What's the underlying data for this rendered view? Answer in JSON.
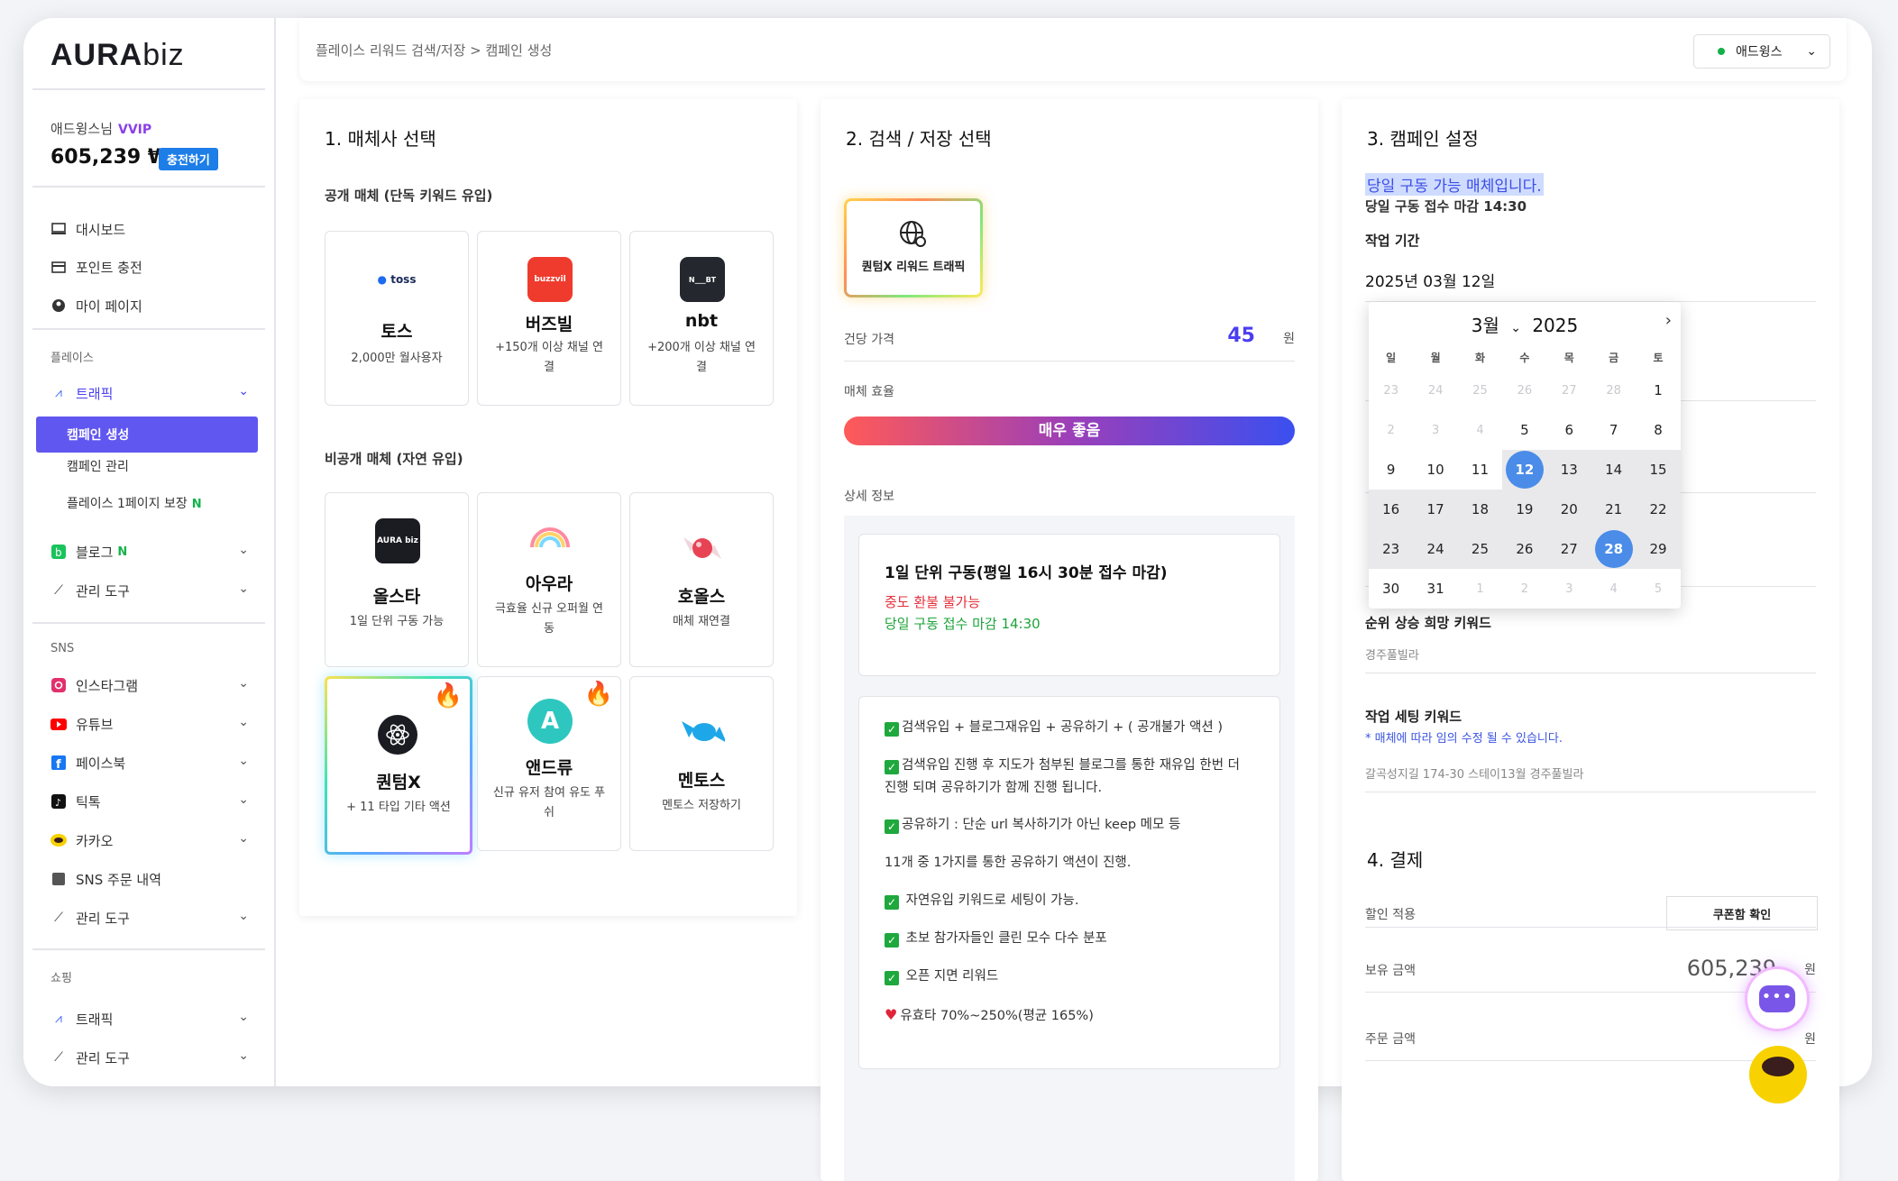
{
  "brand": {
    "name_main": "AURA",
    "name_sub": "biz"
  },
  "user": {
    "name": "애드윙스님",
    "tier": "VVIP",
    "balance": "605,239 ₩",
    "charge_label": "충전하기"
  },
  "sidebar": {
    "top": [
      {
        "label": "대시보드",
        "icon": "monitor-icon"
      },
      {
        "label": "포인트 충전",
        "icon": "card-icon"
      },
      {
        "label": "마이 페이지",
        "icon": "user-icon"
      }
    ],
    "place_title": "플레이스",
    "traffic": "트래픽",
    "campaign_create": "캠페인 생성",
    "campaign_manage": "캠페인 관리",
    "place_first_page": "플레이스 1페이지 보장",
    "new_badge": "N",
    "blog": "블로그",
    "manage_tool": "관리 도구",
    "sns_title": "SNS",
    "sns": [
      "인스타그램",
      "유튜브",
      "페이스북",
      "틱톡",
      "카카오"
    ],
    "sns_orders": "SNS 주문 내역",
    "shopping_title": "쇼핑"
  },
  "header": {
    "breadcrumb": "플레이스 리워드 검색/저장 > 캠페인 생성",
    "account": "애드윙스"
  },
  "panel1": {
    "title": "1. 매체사 선택",
    "public_label": "공개 매체 (단독 키워드 유입)",
    "private_label": "비공개 매체 (자연 유입)",
    "public": [
      {
        "name": "토스",
        "desc": "2,000만 월사용자",
        "logo": "toss"
      },
      {
        "name": "버즈빌",
        "desc": "+150개 이상 채널 연결",
        "logo": "buzzvil"
      },
      {
        "name": "nbt",
        "desc": "+200개 이상 채널 연결",
        "logo": "N___BT"
      }
    ],
    "private": [
      {
        "name": "올스타",
        "desc": "1일 단위 구동 가능",
        "logo": "AURA biz"
      },
      {
        "name": "아우라",
        "desc": "극효율 신규 오퍼월 연동"
      },
      {
        "name": "호올스",
        "desc": "매체 재연결"
      },
      {
        "name": "퀀텀X",
        "desc": "+ 11 타입 기타 액션"
      },
      {
        "name": "앤드류",
        "desc": "신규 유저 참여 유도 푸쉬",
        "logo": "A"
      },
      {
        "name": "멘토스",
        "desc": "멘토스 저장하기"
      }
    ]
  },
  "panel2": {
    "title": "2. 검색 / 저장 선택",
    "method": "퀀텀X 리워드 트래픽",
    "price_label": "건당 가격",
    "price": "45",
    "price_unit": "원",
    "efficiency_label": "매체 효율",
    "efficiency": "매우 좋음",
    "detail_label": "상세 정보",
    "info_title": "1일 단위 구동(평일 16시 30분 접수 마감)",
    "info_red": "중도 환불 불가능",
    "info_green": "당일 구동 접수 마감 14:30",
    "features": [
      "검색유입 + 블로그재유입 + 공유하기 + ( 공개불가 액션 )",
      "검색유입 진행 후 지도가 첨부된 블로그를 통한 재유입 한번 더 진행 되며 공유하기가 함께 진행 됩니다.",
      "공유하기 : 단순 url 복사하기가 아닌 keep 메모 등",
      "11개 중 1가지를 통한 공유하기 액션이 진행.",
      "자연유입 키워드로 세팅이 가능.",
      "초보 참가자들인 클린 모수 다수 분포",
      "오픈 지면 리워드",
      "유효타 70%~250%(평균 165%)"
    ]
  },
  "panel3": {
    "title": "3. 캠페인 설정",
    "avail": "당일 구동 가능 매체입니다.",
    "avail_sub": "당일 구동 접수 마감 14:30",
    "period_label": "작업 기간",
    "period_value": "2025년 03월 12일",
    "rank_label": "순위 상승 희망 키워드",
    "rank_placeholder": "경주풀빌라",
    "setting_label": "작업 세팅 키워드",
    "setting_hint": "* 매체에 따라 임의 수정 될 수 있습니다.",
    "setting_value": "갈곡성지길 174-30 스테이13월 경주풀빌라",
    "payment_title": "4. 결제",
    "discount_label": "할인 적용",
    "coupon_btn": "쿠폰함 확인",
    "owned_label": "보유 금액",
    "owned_value": "605,239",
    "order_label": "주문 금액",
    "won": "원"
  },
  "calendar": {
    "month": "3월",
    "year": "2025",
    "dow": [
      "일",
      "월",
      "화",
      "수",
      "목",
      "금",
      "토"
    ],
    "weeks": [
      [
        "23",
        "24",
        "25",
        "26",
        "27",
        "28",
        "1"
      ],
      [
        "2",
        "3",
        "4",
        "5",
        "6",
        "7",
        "8"
      ],
      [
        "9",
        "10",
        "11",
        "12",
        "13",
        "14",
        "15"
      ],
      [
        "16",
        "17",
        "18",
        "19",
        "20",
        "21",
        "22"
      ],
      [
        "23",
        "24",
        "25",
        "26",
        "27",
        "28",
        "29"
      ],
      [
        "30",
        "31",
        "1",
        "2",
        "3",
        "4",
        "5"
      ]
    ],
    "start": "12",
    "end": "28"
  },
  "fab": {
    "chat": "•••"
  }
}
